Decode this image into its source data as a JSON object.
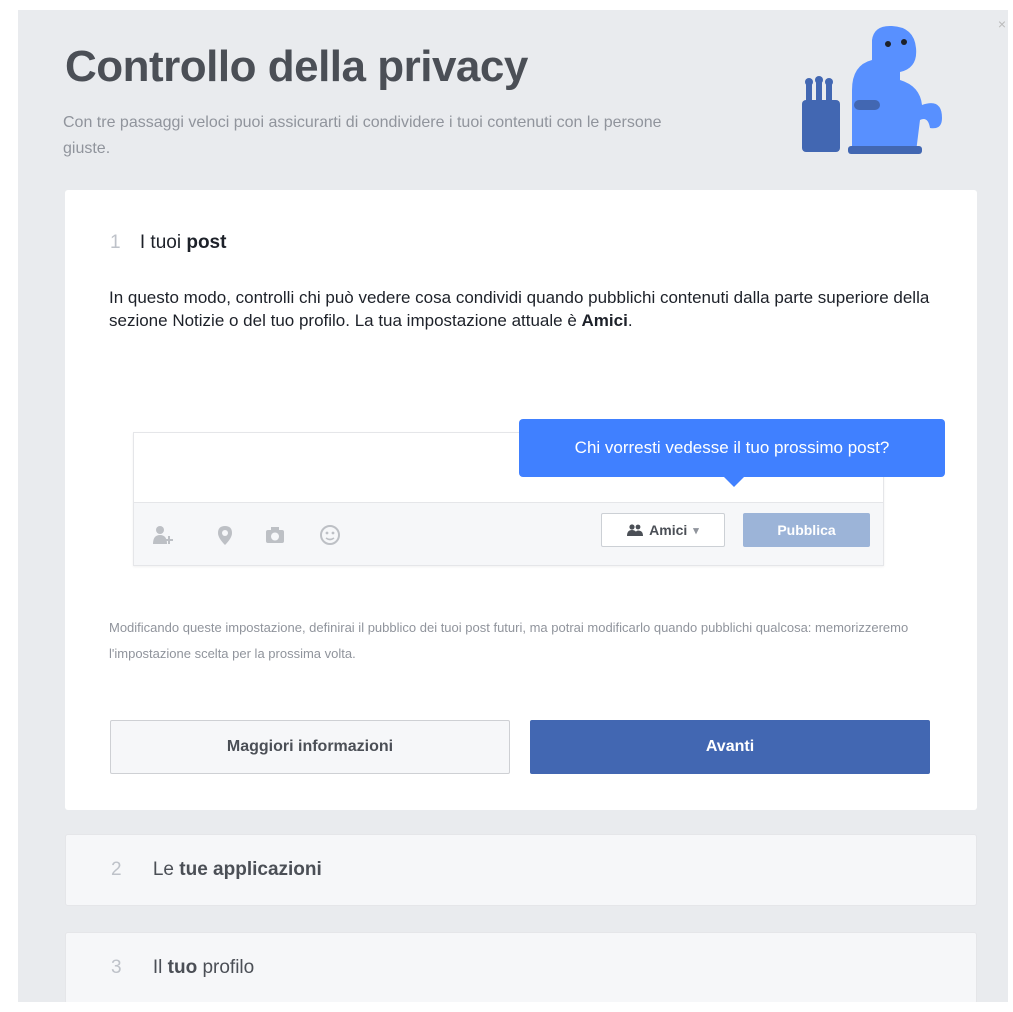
{
  "dialog": {
    "title": "Controllo della privacy",
    "subtitle": "Con tre passaggi veloci puoi assicurarti di condividere i tuoi contenuti con le persone giuste.",
    "close_glyph": "×",
    "mascot_icon": "privacy-dinosaur-icon"
  },
  "step1": {
    "number": "1",
    "title_prefix": "I tuoi",
    "title_bold": "post",
    "description_text": "In questo modo, controlli chi può vedere cosa condividi quando pubblichi contenuti dalla parte superiore della sezione Notizie o del tuo profilo. La tua impostazione attuale è",
    "current_setting": "Amici",
    "description_end": ".",
    "composer": {
      "tooltip": "Chi vorresti vedesse il tuo prossimo post?",
      "tool_icons": [
        "tag-friends-icon",
        "location-pin-icon",
        "camera-icon",
        "feeling-smiley-icon"
      ],
      "audience_label": "Amici",
      "audience_caret": "▾",
      "publish_label": "Pubblica"
    },
    "note": "Modificando queste impostazione, definirai il pubblico dei tuoi post futuri, ma potrai modificarlo quando pubblichi qualcosa: memorizzeremo l'impostazione scelta per la prossima volta.",
    "more_info_label": "Maggiori informazioni",
    "next_label": "Avanti"
  },
  "step2": {
    "number": "2",
    "prefix": "Le",
    "bold": "tue applicazioni"
  },
  "step3": {
    "number": "3",
    "prefix": "Il",
    "bold": "tuo",
    "suffix": "profilo"
  },
  "colors": {
    "accent_blue": "#4267b2",
    "tooltip_blue": "#4080ff",
    "publish_disabled": "#9cb4d8",
    "background": "#e9ebee"
  }
}
